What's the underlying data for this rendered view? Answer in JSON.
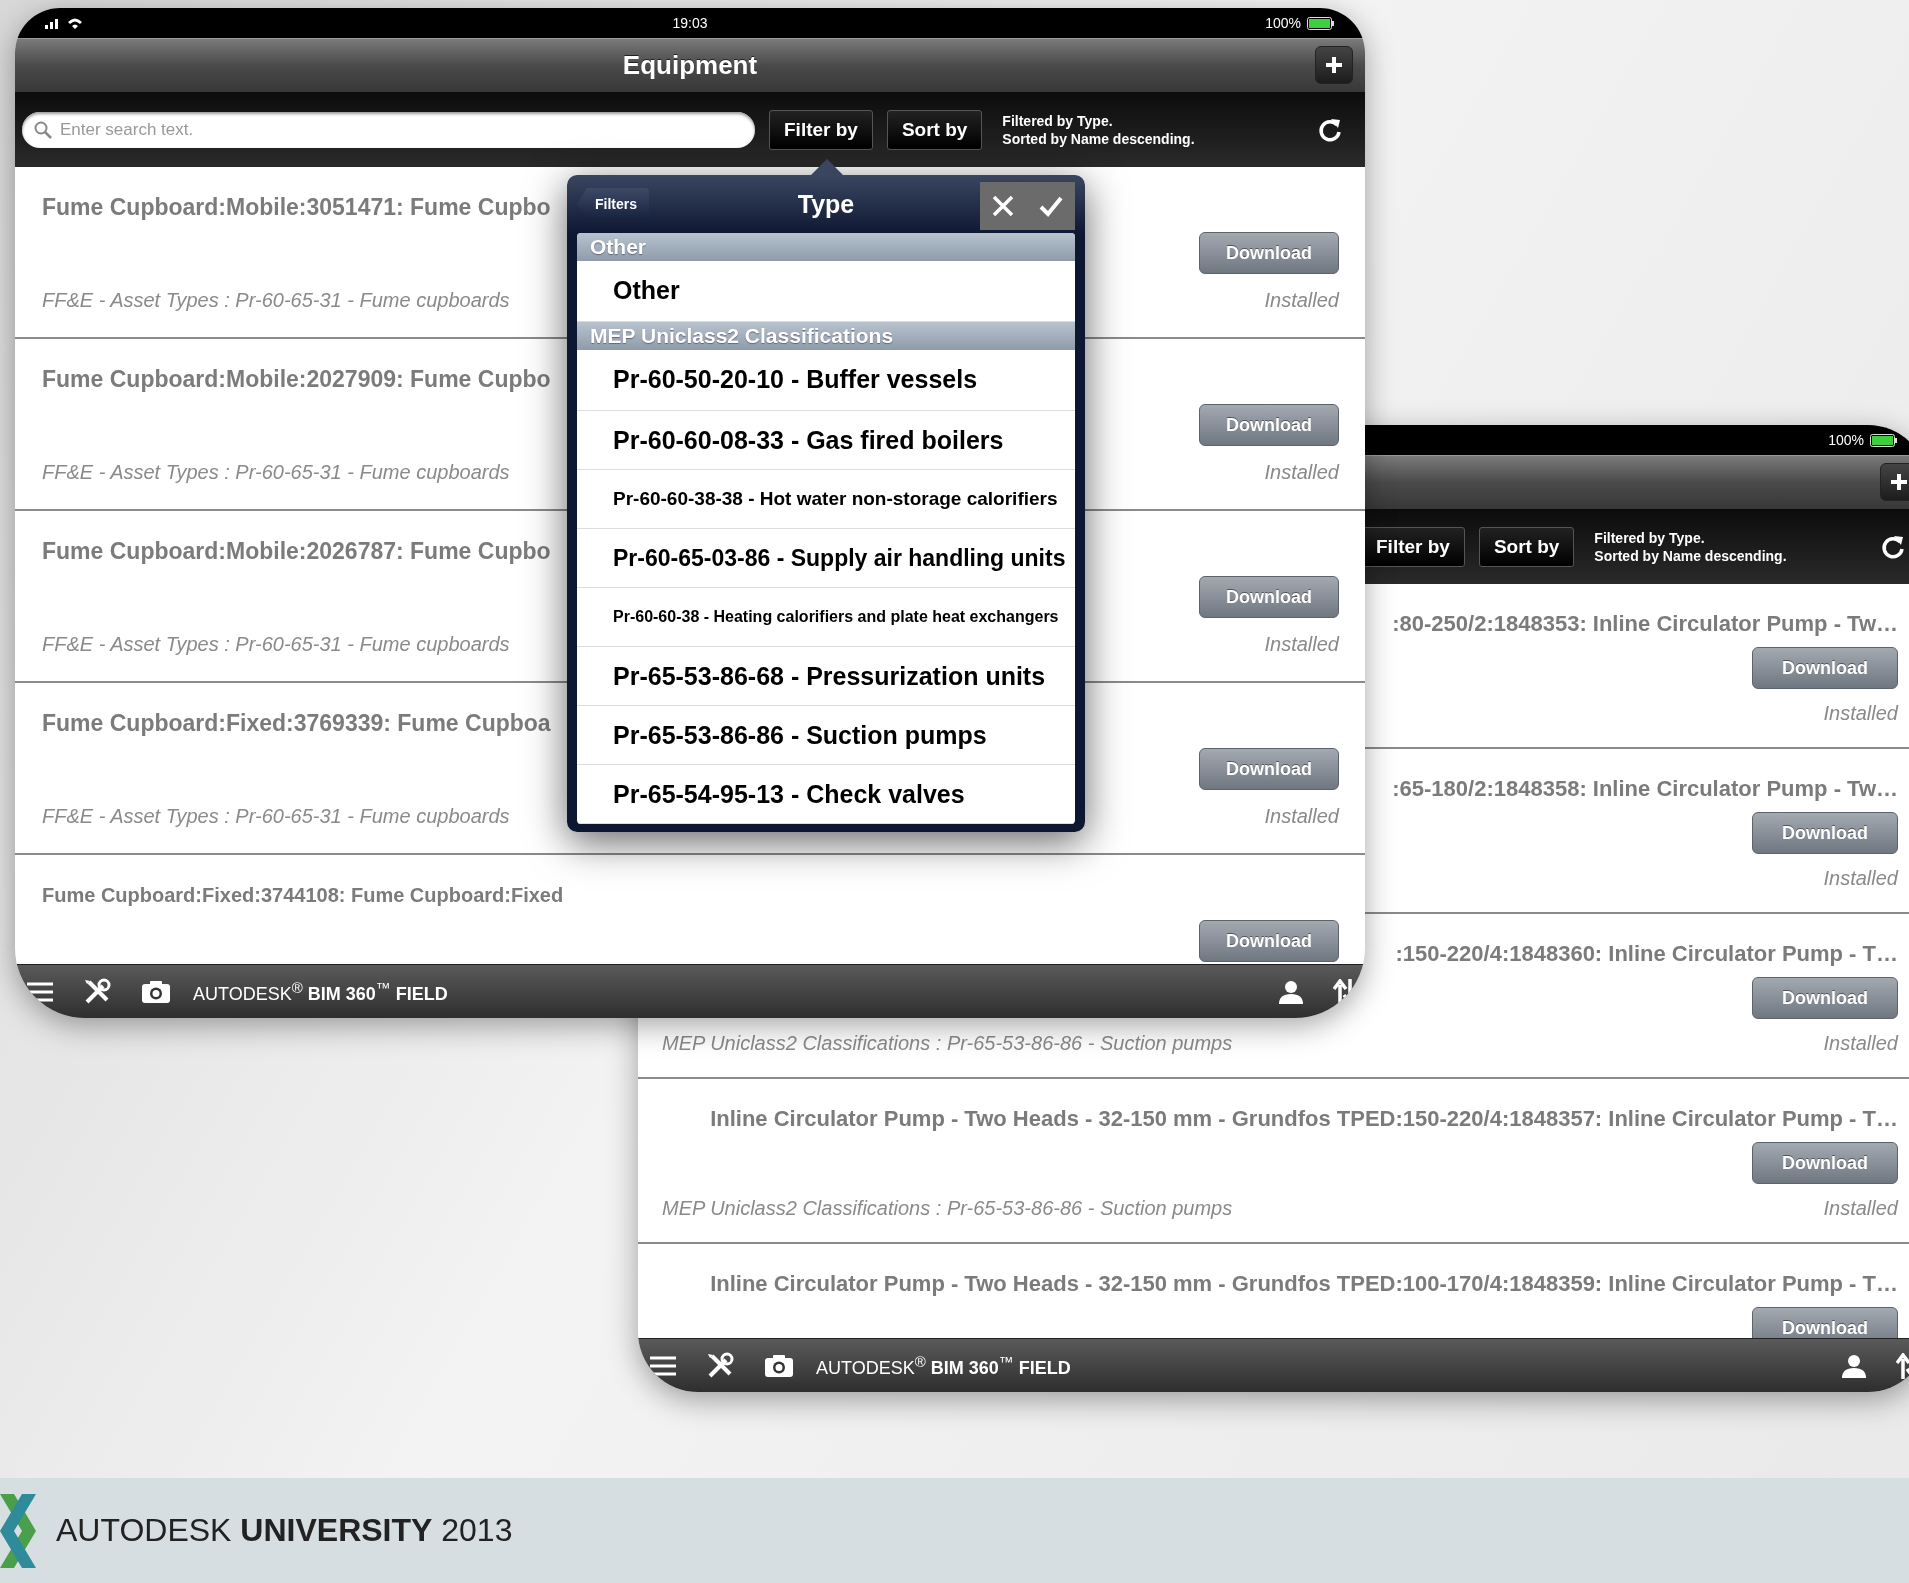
{
  "screens": [
    {
      "status_bar": {
        "time": "19:03",
        "battery": "100%"
      },
      "title": "Equipment",
      "search": {
        "placeholder": "Enter search text."
      },
      "filter_button": "Filter by",
      "sort_button": "Sort by",
      "filter_summary": [
        "Filtered by Type.",
        "Sorted by Name descending."
      ],
      "rows": [
        {
          "title": "Fume Cupboard:Mobile:3051471: Fume Cupbo",
          "button": "Download",
          "description": "FF&E - Asset Types : Pr-60-65-31 - Fume cupboards",
          "status": "Installed"
        },
        {
          "title": "Fume Cupboard:Mobile:2027909: Fume Cupbo",
          "button": "Download",
          "description": "FF&E - Asset Types : Pr-60-65-31 - Fume cupboards",
          "status": "Installed"
        },
        {
          "title": "Fume Cupboard:Mobile:2026787: Fume Cupbo",
          "button": "Download",
          "description": "FF&E - Asset Types : Pr-60-65-31 - Fume cupboards",
          "status": "Installed"
        },
        {
          "title": "Fume Cupboard:Fixed:3769339: Fume Cupboa",
          "button": "Download",
          "description": "FF&E - Asset Types : Pr-60-65-31 - Fume cupboards",
          "status": "Installed"
        },
        {
          "title": "Fume Cupboard:Fixed:3744108: Fume Cupboard:Fixed",
          "button": "Download"
        }
      ],
      "bottom_bar": {
        "brand": "AUTODESK$^{®}$ **BIM 360**$^{™}$ **FIELD**"
      }
    },
    {
      "status_bar": {
        "battery": "100%"
      },
      "filter_button": "Filter by",
      "sort_button": "Sort by",
      "filter_summary": [
        "Filtered by Type.",
        "Sorted by Name descending."
      ],
      "rows": [
        {
          "title": ":80-250/2:1848353: Inline Circulator Pump - Tw…",
          "button": "Download",
          "status": "Installed"
        },
        {
          "title": ":65-180/2:1848358: Inline Circulator Pump - Tw…",
          "button": "Download",
          "status": "Installed"
        },
        {
          "title": ":150-220/4:1848360: Inline Circulator Pump - T…",
          "button": "Download",
          "description": "MEP Uniclass2 Classifications : Pr-65-53-86-86 - Suction pumps",
          "status": "Installed"
        },
        {
          "title": "Inline Circulator Pump - Two Heads - 32-150 mm - Grundfos TPED:150-220/4:1848357: Inline Circulator Pump - T…",
          "button": "Download",
          "description": "MEP Uniclass2 Classifications : Pr-65-53-86-86 - Suction pumps",
          "status": "Installed"
        },
        {
          "title": "Inline Circulator Pump - Two Heads - 32-150 mm - Grundfos TPED:100-170/4:1848359: Inline Circulator Pump - T…",
          "button": "Download"
        }
      ],
      "bottom_bar": {
        "brand": "AUTODESK$^{®}$ **BIM 360**$^{™}$ **FIELD**"
      }
    }
  ],
  "popover": {
    "back_button": "Filters",
    "title": "Type",
    "sections": [
      {
        "header": "Other",
        "items": [
          "Other"
        ]
      },
      {
        "header": "MEP Uniclass2 Classifications",
        "items": [
          "Pr-60-50-20-10 - Buffer vessels",
          "Pr-60-60-08-33 - Gas fired boilers",
          "Pr-60-60-38-38 - Hot water non-storage calorifiers",
          "Pr-60-65-03-86 - Supply air handling units",
          "Pr-60-60-38 - Heating calorifiers and plate heat exchangers",
          "Pr-65-53-86-68 - Pressurization units",
          "Pr-65-53-86-86 - Suction pumps",
          "Pr-65-54-95-13 - Check valves"
        ]
      }
    ]
  },
  "footer": {
    "text": "AUTODESK **UNIVERSITY** 2013"
  }
}
